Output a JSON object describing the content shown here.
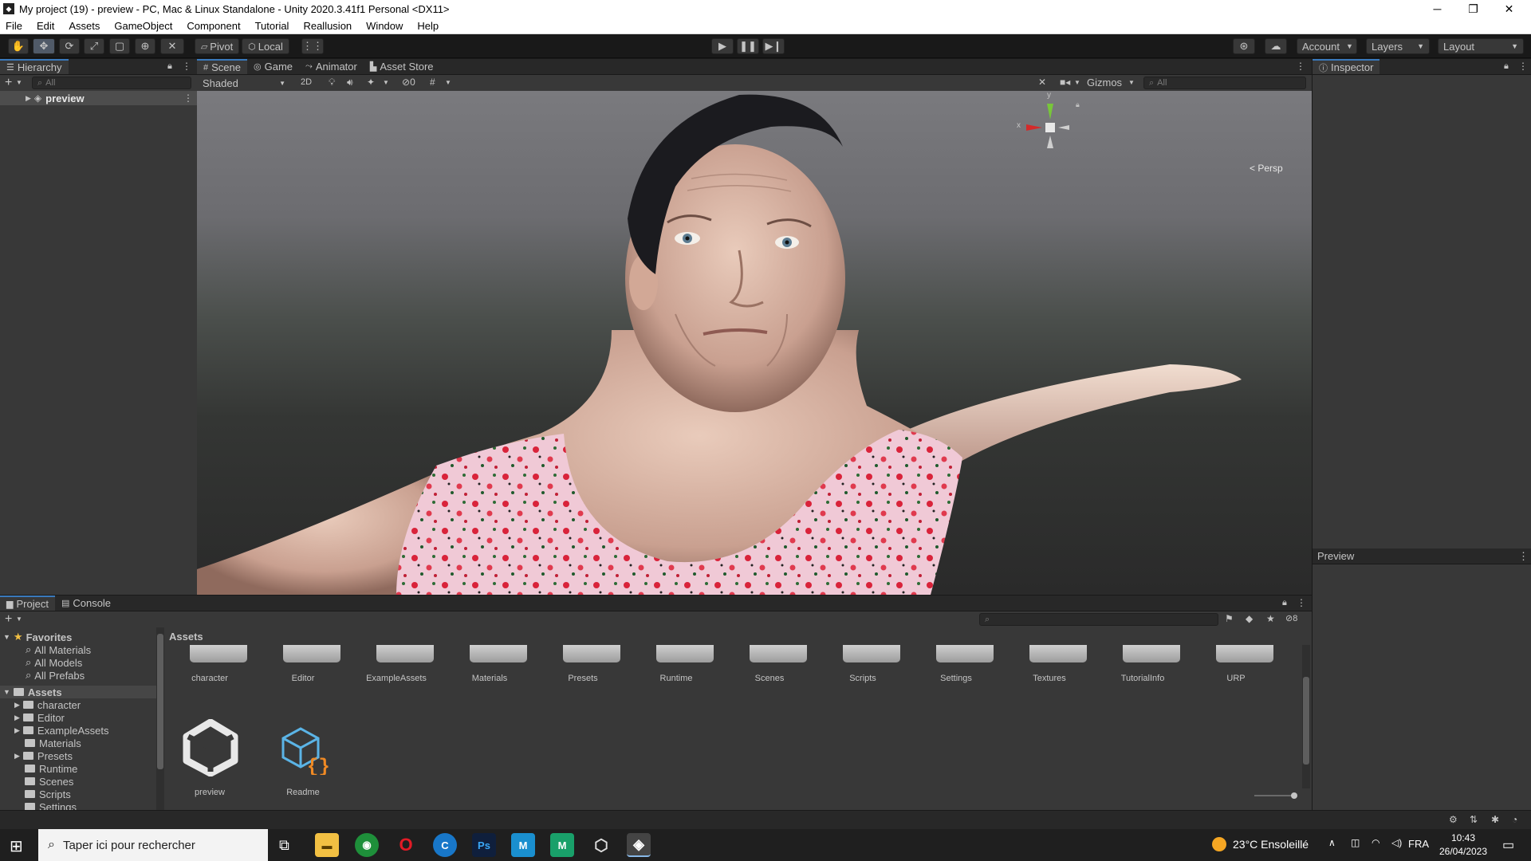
{
  "window": {
    "title": "My project (19) - preview - PC, Mac & Linux Standalone - Unity 2020.3.41f1 Personal <DX11>",
    "minimize": "─",
    "maximize": "❐",
    "close": "✕"
  },
  "menu": [
    "File",
    "Edit",
    "Assets",
    "GameObject",
    "Component",
    "Tutorial",
    "Reallusion",
    "Window",
    "Help"
  ],
  "toolbar": {
    "pivot": "Pivot",
    "local": "Local",
    "account": "Account",
    "layers": "Layers",
    "layout": "Layout"
  },
  "hierarchy": {
    "tab": "Hierarchy",
    "search_placeholder": "All",
    "items": [
      "preview"
    ]
  },
  "scene": {
    "tabs": [
      "Scene",
      "Game",
      "Animator",
      "Asset Store"
    ],
    "shading": "Shaded",
    "mode_2d": "2D",
    "hidden_count": "0",
    "gizmos": "Gizmos",
    "search_placeholder": "All",
    "projection": "Persp",
    "axis_x": "x",
    "axis_y": "y"
  },
  "inspector": {
    "tab": "Inspector",
    "preview": "Preview"
  },
  "project": {
    "tabs": [
      "Project",
      "Console"
    ],
    "badge_count": "8",
    "breadcrumb": "Assets",
    "favorites_label": "Favorites",
    "favorites": [
      "All Materials",
      "All Models",
      "All Prefabs"
    ],
    "assets_label": "Assets",
    "tree": [
      "character",
      "Editor",
      "ExampleAssets",
      "Materials",
      "Presets",
      "Runtime",
      "Scenes",
      "Scripts",
      "Settings"
    ],
    "grid_folders": [
      "character",
      "Editor",
      "ExampleAssets",
      "Materials",
      "Presets",
      "Runtime",
      "Scenes",
      "Scripts",
      "Settings",
      "Textures",
      "TutorialInfo",
      "URP"
    ],
    "grid_files": [
      "preview",
      "Readme"
    ]
  },
  "taskbar": {
    "search_placeholder": "Taper ici pour rechercher",
    "weather": "23°C  Ensoleillé",
    "language": "FRA",
    "time": "10:43",
    "date": "26/04/2023",
    "apps": [
      "Ps",
      "M",
      "M"
    ]
  }
}
